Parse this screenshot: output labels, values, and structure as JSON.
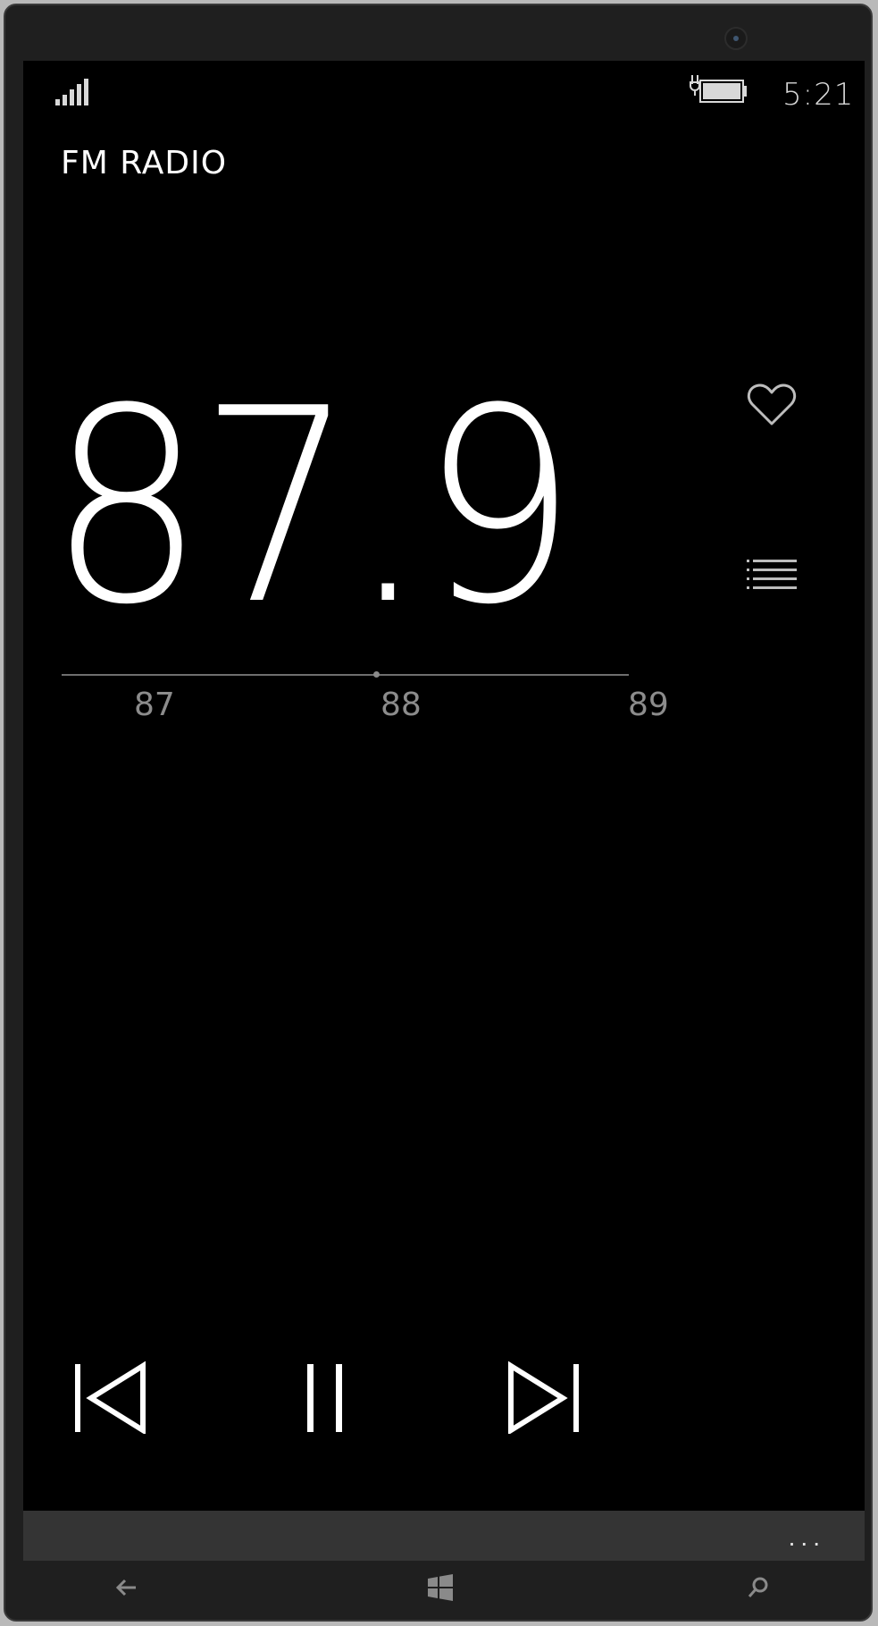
{
  "status_bar": {
    "time": "5:21",
    "signal_icon": "signal-bars-icon",
    "battery_icon": "battery-charging-icon"
  },
  "app": {
    "title": "FM RADIO"
  },
  "tuner": {
    "frequency": "87.9",
    "scale": [
      {
        "label": "87"
      },
      {
        "label": "88"
      },
      {
        "label": "89"
      }
    ],
    "favorite_icon": "heart-outline-icon",
    "stations_icon": "list-icon"
  },
  "controls": {
    "previous_icon": "skip-previous-icon",
    "pause_icon": "pause-icon",
    "next_icon": "skip-next-icon"
  },
  "app_bar": {
    "more_label": "..."
  },
  "nav_bar": {
    "back_icon": "back-arrow-icon",
    "start_icon": "windows-logo-icon",
    "search_icon": "search-icon"
  },
  "colors": {
    "screen_bg": "#000000",
    "text_primary": "#ffffff",
    "text_secondary": "#8c8c8c",
    "appbar_bg": "#343434",
    "phone_bezel": "#1f1f1f"
  }
}
